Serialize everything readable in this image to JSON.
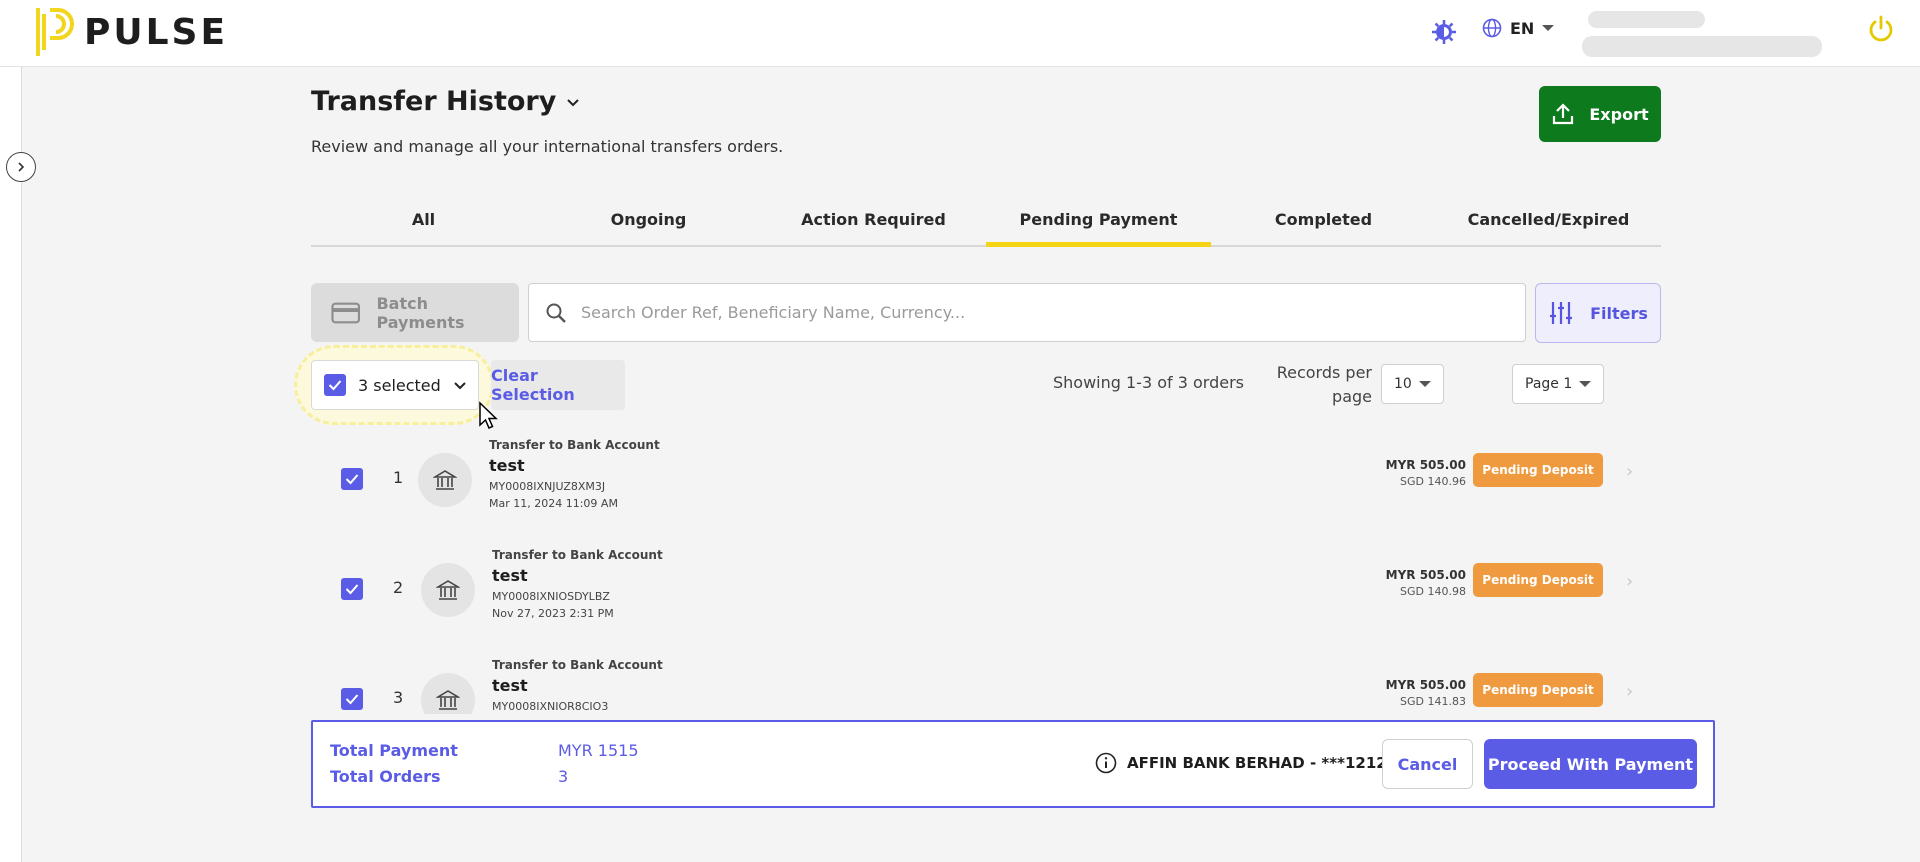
{
  "header": {
    "brand": "PULSE",
    "language": "EN"
  },
  "page": {
    "title": "Transfer History",
    "subtitle": "Review and manage all your international transfers orders.",
    "export_label": "Export"
  },
  "tabs": [
    {
      "label": "All"
    },
    {
      "label": "Ongoing"
    },
    {
      "label": "Action Required"
    },
    {
      "label": "Pending Payment",
      "active": true
    },
    {
      "label": "Completed"
    },
    {
      "label": "Cancelled/Expired"
    }
  ],
  "toolbar": {
    "batch_label": "Batch Payments",
    "search_placeholder": "Search Order Ref, Beneficiary Name, Currency...",
    "filters_label": "Filters"
  },
  "selection": {
    "selected_label": "3 selected",
    "clear_label": "Clear Selection"
  },
  "pagination": {
    "showing": "Showing 1-3 of 3 orders",
    "records_label": "Records per page",
    "records_value": "10",
    "page_value": "Page 1"
  },
  "orders": [
    {
      "num": "1",
      "kind": "Transfer to Bank Account",
      "name": "test",
      "ref": "MY0008IXNJUZ8XM3J",
      "date": "Mar 11, 2024 11:09 AM",
      "amount": "MYR 505.00",
      "converted": "SGD 140.96",
      "status": "Pending Deposit"
    },
    {
      "num": "2",
      "kind": "Transfer to Bank Account",
      "name": "test",
      "ref": "MY0008IXNIOSDYLBZ",
      "date": "Nov 27, 2023 2:31 PM",
      "amount": "MYR 505.00",
      "converted": "SGD 140.98",
      "status": "Pending Deposit"
    },
    {
      "num": "3",
      "kind": "Transfer to Bank Account",
      "name": "test",
      "ref": "MY0008IXNIOR8CIO3",
      "date": "",
      "amount": "MYR 505.00",
      "converted": "SGD 141.83",
      "status": "Pending Deposit"
    }
  ],
  "paybar": {
    "total_payment_label": "Total Payment",
    "total_payment_value": "MYR 1515",
    "total_orders_label": "Total Orders",
    "total_orders_value": "3",
    "bank": "AFFIN BANK BERHAD - ***1212",
    "cancel_label": "Cancel",
    "proceed_label": "Proceed With Payment"
  },
  "colors": {
    "accent": "#5b5ce6",
    "export": "#0d7a1e",
    "tab_indicator": "#f4d415",
    "status_pending": "#f09a40"
  }
}
